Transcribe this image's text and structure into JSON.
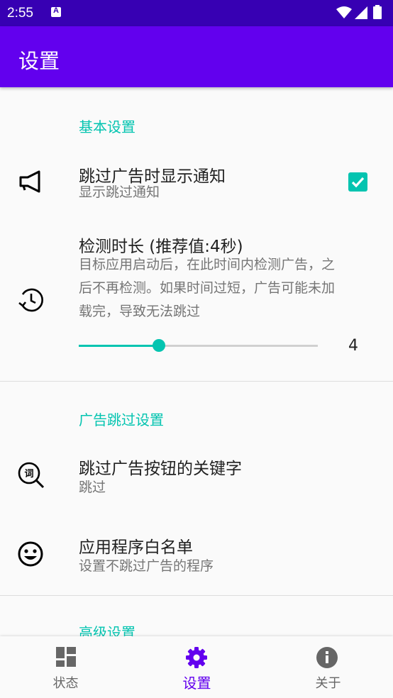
{
  "status_bar": {
    "time": "2:55",
    "icons": [
      "notification-a-icon",
      "wifi-icon",
      "signal-icon",
      "battery-icon"
    ]
  },
  "app_bar": {
    "title": "设置"
  },
  "sections": [
    {
      "title": "基本设置",
      "items": [
        {
          "icon": "megaphone-icon",
          "title": "跳过广告时显示通知",
          "summary": "显示跳过通知",
          "checked": true
        },
        {
          "icon": "timer-icon",
          "title": "检测时长 (推荐值:4秒)",
          "summary_lines": [
            "目标应用启动后，在此时间内检测广告，之",
            "后不再检测。如果时间过短，广告可能未加",
            "载完，导致无法跳过"
          ],
          "slider_value": "4"
        }
      ]
    },
    {
      "title": "广告跳过设置",
      "items": [
        {
          "icon": "keyword-search-icon",
          "title": "跳过广告按钮的关键字",
          "summary": "跳过"
        },
        {
          "icon": "smiley-icon",
          "title": "应用程序白名单",
          "summary": "设置不跳过广告的程序"
        }
      ]
    },
    {
      "title": "高级设置"
    }
  ],
  "bottom_nav": [
    {
      "label": "状态",
      "icon": "dashboard-icon",
      "active": false
    },
    {
      "label": "设置",
      "icon": "gear-icon",
      "active": true
    },
    {
      "label": "关于",
      "icon": "info-icon",
      "active": false
    }
  ],
  "colors": {
    "primary": "#6200ee",
    "primary_dark": "#3700b3",
    "accent": "#03c4b0"
  }
}
